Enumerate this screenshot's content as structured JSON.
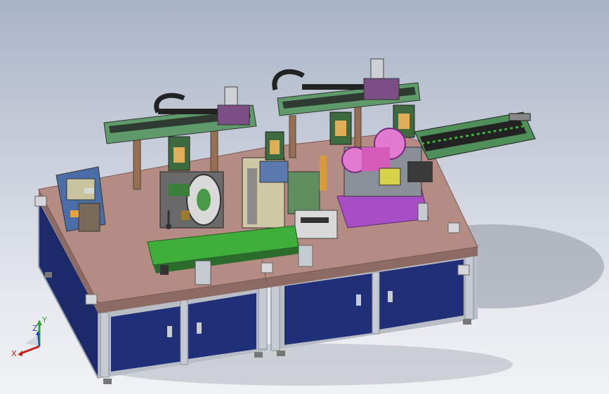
{
  "viewport": {
    "background_top": "#a9b4c7",
    "background_bottom": "#f1f2f5"
  },
  "model": {
    "colors": {
      "table_top": "#b48c84",
      "table_edge": "#8d6a63",
      "cabinet_panel": "#1f2f78",
      "cabinet_frame": "#b9bec6",
      "gantry_green": "#5f9a6b",
      "gantry_dark": "#333333",
      "conveyor_green": "#3fae3b",
      "part_purple": "#a94ec6",
      "part_pink": "#e27ad2",
      "part_yellow": "#d8d24a",
      "shadow": "#8f95a3"
    }
  },
  "triad": {
    "x_label": "X",
    "y_label": "Y",
    "z_label": "Z",
    "x_color": "#c41e1e",
    "y_color": "#2fa52f",
    "z_color": "#1f3fc4"
  }
}
